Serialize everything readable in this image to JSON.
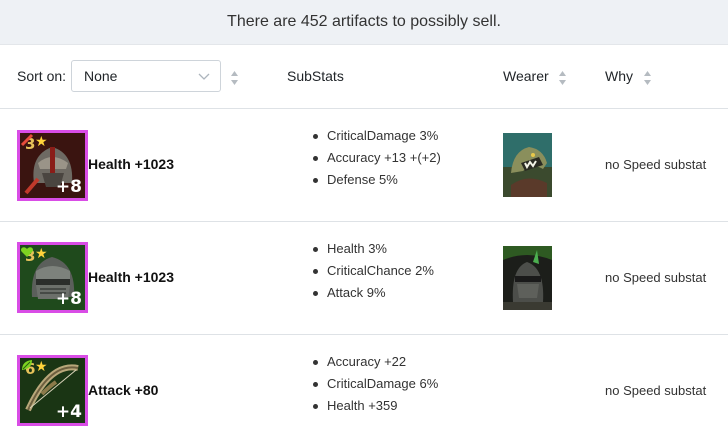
{
  "banner": {
    "text": "There are 452 artifacts to possibly sell."
  },
  "header": {
    "sort_label": "Sort on:",
    "sort_value": "None",
    "col_substats": "SubStats",
    "col_wearer": "Wearer",
    "col_why": "Why"
  },
  "rows": [
    {
      "level": "3",
      "plus": "+8",
      "main_stat": "Health +1023",
      "substats": [
        "CriticalDamage 3%",
        "Accuracy +13 +(+2)",
        "Defense 5%"
      ],
      "why": "no Speed substat",
      "icon": "helmet-icon",
      "wearer": "lizard-champion-portrait"
    },
    {
      "level": "3",
      "plus": "+8",
      "main_stat": "Health +1023",
      "substats": [
        "Health 3%",
        "CriticalChance 2%",
        "Attack 9%"
      ],
      "why": "no Speed substat",
      "icon": "helmet-icon",
      "wearer": "knight-champion-portrait"
    },
    {
      "level": "6",
      "plus": "+4",
      "main_stat": "Attack +80",
      "substats": [
        "Accuracy +22",
        "CriticalDamage 6%",
        "Health +359"
      ],
      "why": "no Speed substat",
      "icon": "bow-weapon-icon",
      "wearer": ""
    }
  ],
  "colors": {
    "rarity_border": "#d94de6",
    "banner_bg": "#eef1f5",
    "level_gold": "#e6c25a"
  }
}
